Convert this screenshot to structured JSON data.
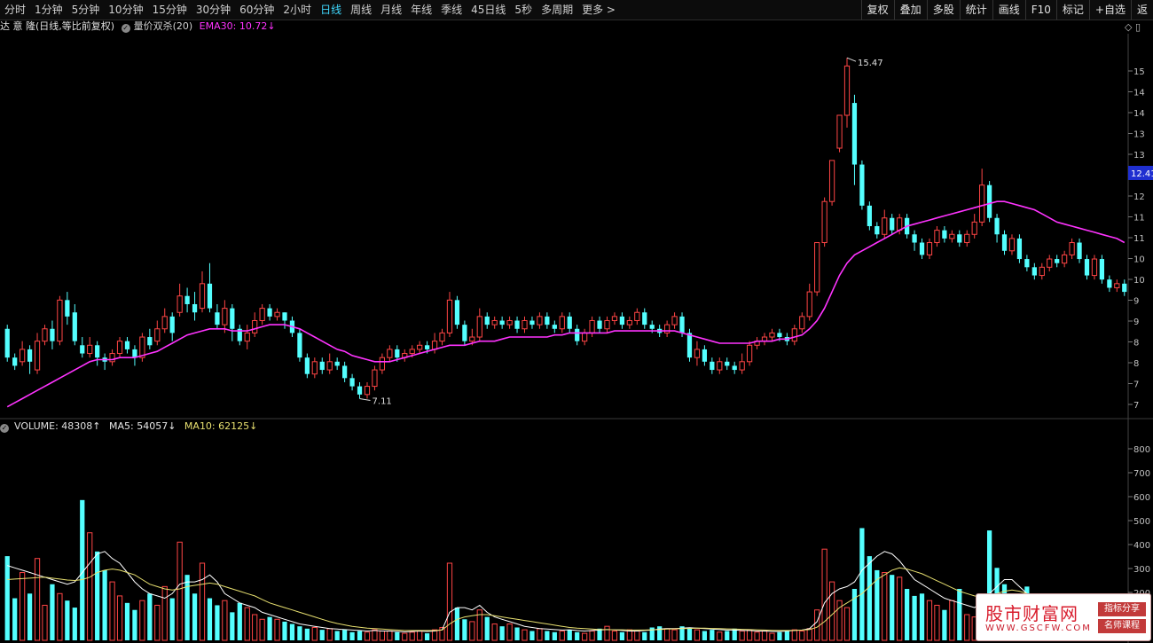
{
  "toolbar": {
    "periods": [
      "分时",
      "1分钟",
      "5分钟",
      "10分钟",
      "15分钟",
      "30分钟",
      "60分钟",
      "2小时",
      "日线",
      "周线",
      "月线",
      "年线",
      "季线",
      "45日线",
      "5秒",
      "多周期",
      "更多"
    ],
    "active_period": "日线",
    "more_arrow": ">",
    "tools": [
      "复权",
      "叠加",
      "多股",
      "统计",
      "画线",
      "F10",
      "标记",
      "+自选",
      "返"
    ]
  },
  "info": {
    "stock": "达 意 隆(日线,等比前复权)",
    "indicator": "量价双杀(20)",
    "ema": "EMA30: 10.72↓",
    "corner": "◇ ▯"
  },
  "volume_line": {
    "vol": "VOLUME: 48308↑",
    "ma5": "MA5: 54057↓",
    "ma10": "MA10: 62125↓"
  },
  "price_axis": [
    "15",
    "14",
    "14",
    "13",
    "13",
    "12",
    "12",
    "11",
    "11",
    "10",
    "10",
    "9",
    "9",
    "8",
    "8",
    "7",
    "7"
  ],
  "current_price_tag": "12.41",
  "volume_axis": [
    "800",
    "700",
    "600",
    "500",
    "400",
    "300",
    "200"
  ],
  "annotations": {
    "high": "15.47",
    "low": "7.11"
  },
  "colors": {
    "up": "#ff3b3b",
    "up_hollow": "#ff4545",
    "down": "#54ffff",
    "ema": "#ff33ff",
    "ma5": "#ffffff",
    "ma10": "#e8e070",
    "green_bar": "#22ee22",
    "yellow_bar": "#ffcc00"
  },
  "watermark": {
    "title": "股市财富网",
    "url": "WWW.GSCFW.COM",
    "tag1": "指标分享",
    "tag2": "名师课程"
  },
  "chart_data": {
    "type": "candlestick",
    "price_range": [
      6.8,
      16.0
    ],
    "volume_range": [
      0,
      880
    ],
    "candles": [
      [
        8.9,
        8.2,
        9.0,
        8.1
      ],
      [
        8.2,
        8.0,
        8.3,
        7.9
      ],
      [
        8.1,
        8.4,
        8.6,
        8.0
      ],
      [
        8.4,
        8.1,
        8.5,
        7.8
      ],
      [
        7.9,
        8.6,
        8.8,
        7.8
      ],
      [
        8.6,
        8.9,
        9.0,
        8.5
      ],
      [
        8.9,
        8.6,
        9.1,
        8.4
      ],
      [
        8.6,
        9.6,
        9.7,
        8.5
      ],
      [
        9.6,
        9.2,
        9.8,
        9.0
      ],
      [
        9.3,
        8.6,
        9.5,
        8.5
      ],
      [
        8.5,
        8.3,
        8.7,
        8.2
      ],
      [
        8.3,
        8.5,
        8.7,
        8.2
      ],
      [
        8.5,
        8.2,
        8.6,
        8.0
      ],
      [
        8.2,
        8.1,
        8.3,
        7.9
      ],
      [
        8.1,
        8.3,
        8.4,
        8.0
      ],
      [
        8.3,
        8.6,
        8.7,
        8.2
      ],
      [
        8.6,
        8.4,
        8.7,
        8.3
      ],
      [
        8.4,
        8.2,
        8.5,
        8.0
      ],
      [
        8.2,
        8.7,
        8.8,
        8.1
      ],
      [
        8.7,
        8.5,
        8.9,
        8.4
      ],
      [
        8.6,
        8.9,
        9.1,
        8.5
      ],
      [
        8.9,
        9.2,
        9.4,
        8.8
      ],
      [
        9.2,
        8.8,
        9.3,
        8.6
      ],
      [
        9.3,
        9.7,
        10.0,
        9.2
      ],
      [
        9.7,
        9.5,
        9.9,
        9.3
      ],
      [
        9.5,
        9.3,
        9.8,
        9.1
      ],
      [
        9.4,
        10.0,
        10.3,
        9.3
      ],
      [
        10.0,
        9.4,
        10.5,
        9.3
      ],
      [
        9.3,
        9.0,
        9.5,
        8.9
      ],
      [
        9.0,
        9.4,
        9.6,
        8.8
      ],
      [
        9.4,
        8.9,
        9.5,
        8.6
      ],
      [
        8.9,
        8.6,
        9.0,
        8.5
      ],
      [
        8.6,
        8.8,
        9.0,
        8.4
      ],
      [
        8.8,
        9.1,
        9.3,
        8.7
      ],
      [
        9.1,
        9.4,
        9.5,
        9.0
      ],
      [
        9.4,
        9.2,
        9.5,
        9.1
      ],
      [
        9.2,
        9.3,
        9.4,
        9.1
      ],
      [
        9.3,
        9.1,
        9.3,
        8.9
      ],
      [
        9.1,
        8.8,
        9.2,
        8.7
      ],
      [
        8.8,
        8.2,
        8.9,
        8.1
      ],
      [
        8.2,
        7.8,
        8.3,
        7.7
      ],
      [
        7.8,
        8.1,
        8.2,
        7.7
      ],
      [
        8.1,
        7.9,
        8.2,
        7.8
      ],
      [
        7.9,
        8.1,
        8.3,
        7.8
      ],
      [
        8.1,
        8.0,
        8.2,
        7.9
      ],
      [
        8.0,
        7.7,
        8.1,
        7.6
      ],
      [
        7.7,
        7.5,
        7.8,
        7.4
      ],
      [
        7.5,
        7.3,
        7.6,
        7.2
      ],
      [
        7.3,
        7.5,
        7.6,
        7.2
      ],
      [
        7.5,
        7.9,
        8.0,
        7.4
      ],
      [
        7.9,
        8.2,
        8.3,
        7.8
      ],
      [
        8.2,
        8.4,
        8.5,
        8.1
      ],
      [
        8.4,
        8.2,
        8.5,
        8.1
      ],
      [
        8.2,
        8.3,
        8.4,
        8.1
      ],
      [
        8.3,
        8.4,
        8.5,
        8.2
      ],
      [
        8.4,
        8.5,
        8.6,
        8.3
      ],
      [
        8.5,
        8.4,
        8.6,
        8.3
      ],
      [
        8.4,
        8.6,
        8.8,
        8.3
      ],
      [
        8.6,
        8.8,
        8.9,
        8.5
      ],
      [
        8.8,
        9.6,
        9.8,
        8.7
      ],
      [
        9.6,
        9.0,
        9.7,
        8.9
      ],
      [
        9.0,
        8.6,
        9.1,
        8.5
      ],
      [
        8.6,
        8.7,
        8.9,
        8.5
      ],
      [
        8.7,
        9.2,
        9.4,
        8.6
      ],
      [
        9.2,
        9.0,
        9.3,
        8.9
      ],
      [
        9.0,
        9.1,
        9.2,
        8.9
      ],
      [
        9.1,
        9.0,
        9.2,
        8.9
      ],
      [
        9.0,
        9.1,
        9.2,
        8.9
      ],
      [
        9.1,
        8.9,
        9.2,
        8.8
      ],
      [
        8.9,
        9.1,
        9.2,
        8.8
      ],
      [
        9.1,
        9.0,
        9.2,
        8.9
      ],
      [
        9.0,
        9.2,
        9.3,
        8.9
      ],
      [
        9.2,
        9.0,
        9.3,
        8.9
      ],
      [
        9.0,
        8.9,
        9.1,
        8.8
      ],
      [
        8.9,
        9.2,
        9.3,
        8.8
      ],
      [
        9.2,
        8.9,
        9.3,
        8.8
      ],
      [
        8.9,
        8.6,
        9.0,
        8.5
      ],
      [
        8.6,
        8.8,
        8.9,
        8.5
      ],
      [
        8.8,
        9.1,
        9.2,
        8.7
      ],
      [
        9.1,
        8.9,
        9.2,
        8.8
      ],
      [
        8.9,
        9.1,
        9.2,
        8.8
      ],
      [
        9.1,
        9.2,
        9.3,
        9.0
      ],
      [
        9.2,
        9.0,
        9.3,
        8.9
      ],
      [
        9.0,
        9.1,
        9.2,
        8.9
      ],
      [
        9.1,
        9.3,
        9.4,
        9.0
      ],
      [
        9.3,
        9.0,
        9.4,
        8.9
      ],
      [
        9.0,
        8.9,
        9.1,
        8.8
      ],
      [
        8.9,
        8.8,
        9.0,
        8.7
      ],
      [
        8.8,
        9.0,
        9.1,
        8.7
      ],
      [
        9.0,
        9.2,
        9.3,
        8.9
      ],
      [
        9.2,
        8.8,
        9.3,
        8.7
      ],
      [
        8.8,
        8.2,
        8.9,
        8.1
      ],
      [
        8.2,
        8.4,
        8.6,
        8.0
      ],
      [
        8.4,
        8.1,
        8.5,
        8.0
      ],
      [
        8.1,
        7.9,
        8.2,
        7.8
      ],
      [
        7.9,
        8.1,
        8.2,
        7.8
      ],
      [
        8.1,
        8.0,
        8.2,
        7.9
      ],
      [
        8.0,
        7.9,
        8.1,
        7.8
      ],
      [
        7.9,
        8.1,
        8.3,
        7.8
      ],
      [
        8.1,
        8.5,
        8.6,
        8.0
      ],
      [
        8.5,
        8.6,
        8.7,
        8.4
      ],
      [
        8.6,
        8.7,
        8.8,
        8.5
      ],
      [
        8.7,
        8.8,
        8.9,
        8.6
      ],
      [
        8.8,
        8.7,
        8.9,
        8.6
      ],
      [
        8.7,
        8.6,
        8.8,
        8.5
      ],
      [
        8.6,
        8.9,
        9.0,
        8.5
      ],
      [
        8.9,
        9.2,
        9.3,
        8.8
      ],
      [
        9.2,
        9.8,
        10.0,
        9.1
      ],
      [
        9.8,
        11.0,
        11.0,
        9.7
      ],
      [
        11.0,
        12.0,
        12.1,
        10.9
      ],
      [
        12.0,
        13.0,
        13.0,
        11.9
      ],
      [
        13.3,
        14.1,
        14.1,
        13.2
      ],
      [
        14.1,
        15.3,
        15.5,
        13.8
      ],
      [
        14.4,
        12.9,
        14.6,
        12.4
      ],
      [
        12.9,
        11.9,
        13.0,
        11.8
      ],
      [
        11.9,
        11.4,
        12.0,
        11.3
      ],
      [
        11.4,
        11.2,
        11.5,
        11.1
      ],
      [
        11.2,
        11.6,
        11.8,
        11.1
      ],
      [
        11.6,
        11.3,
        11.7,
        11.2
      ],
      [
        11.3,
        11.6,
        11.7,
        11.2
      ],
      [
        11.6,
        11.2,
        11.7,
        11.1
      ],
      [
        11.2,
        11.0,
        11.3,
        10.8
      ],
      [
        11.0,
        10.7,
        11.1,
        10.6
      ],
      [
        10.7,
        11.0,
        11.1,
        10.6
      ],
      [
        11.0,
        11.3,
        11.4,
        10.9
      ],
      [
        11.3,
        11.1,
        11.4,
        11.0
      ],
      [
        11.1,
        11.2,
        11.3,
        11.0
      ],
      [
        11.2,
        11.0,
        11.3,
        10.9
      ],
      [
        11.0,
        11.2,
        11.3,
        10.9
      ],
      [
        11.2,
        11.5,
        11.7,
        11.1
      ],
      [
        11.5,
        12.4,
        12.8,
        11.4
      ],
      [
        12.4,
        11.6,
        12.5,
        11.5
      ],
      [
        11.6,
        11.2,
        11.7,
        11.0
      ],
      [
        11.2,
        10.8,
        11.3,
        10.7
      ],
      [
        10.8,
        11.1,
        11.2,
        10.7
      ],
      [
        11.1,
        10.6,
        11.2,
        10.5
      ],
      [
        10.6,
        10.4,
        10.7,
        10.3
      ],
      [
        10.4,
        10.2,
        10.5,
        10.1
      ],
      [
        10.2,
        10.4,
        10.5,
        10.1
      ],
      [
        10.4,
        10.6,
        10.7,
        10.3
      ],
      [
        10.6,
        10.5,
        10.7,
        10.4
      ],
      [
        10.5,
        10.7,
        10.8,
        10.4
      ],
      [
        10.7,
        11.0,
        11.1,
        10.6
      ],
      [
        11.0,
        10.6,
        11.1,
        10.5
      ],
      [
        10.6,
        10.2,
        10.7,
        10.1
      ],
      [
        10.2,
        10.6,
        10.7,
        10.1
      ],
      [
        10.6,
        10.1,
        10.7,
        10.0
      ],
      [
        10.1,
        9.9,
        10.2,
        9.8
      ],
      [
        9.9,
        10.0,
        10.1,
        9.8
      ],
      [
        10.0,
        9.8,
        10.1,
        9.7
      ]
    ],
    "volume": [
      360,
      180,
      290,
      200,
      350,
      150,
      240,
      200,
      170,
      140,
      600,
      460,
      380,
      300,
      250,
      190,
      160,
      130,
      170,
      200,
      150,
      230,
      180,
      420,
      280,
      200,
      330,
      180,
      150,
      170,
      120,
      160,
      140,
      110,
      90,
      100,
      90,
      80,
      70,
      60,
      50,
      55,
      45,
      50,
      40,
      45,
      35,
      40,
      35,
      45,
      40,
      40,
      35,
      30,
      35,
      40,
      30,
      45,
      55,
      330,
      140,
      90,
      80,
      130,
      100,
      70,
      60,
      70,
      55,
      45,
      40,
      50,
      40,
      35,
      40,
      45,
      35,
      30,
      40,
      50,
      60,
      40,
      35,
      45,
      40,
      35,
      55,
      60,
      50,
      45,
      60,
      55,
      45,
      40,
      45,
      35,
      40,
      50,
      40,
      45,
      35,
      40,
      30,
      35,
      40,
      45,
      40,
      50,
      130,
      390,
      250,
      170,
      140,
      220,
      480,
      360,
      300,
      290,
      280,
      270,
      220,
      190,
      200,
      170,
      150,
      130,
      170,
      220,
      110,
      100,
      130,
      470,
      310,
      240,
      160,
      90,
      230,
      140,
      150,
      90,
      85,
      150,
      70,
      110,
      80,
      95,
      60,
      70
    ],
    "ema30": [
      7.0,
      7.1,
      7.2,
      7.3,
      7.4,
      7.5,
      7.6,
      7.7,
      7.8,
      7.9,
      8.0,
      8.1,
      8.15,
      8.15,
      8.15,
      8.2,
      8.2,
      8.2,
      8.25,
      8.3,
      8.35,
      8.45,
      8.55,
      8.65,
      8.75,
      8.8,
      8.85,
      8.9,
      8.9,
      8.9,
      8.85,
      8.85,
      8.85,
      8.9,
      8.95,
      9.0,
      9.0,
      9.0,
      8.95,
      8.9,
      8.8,
      8.7,
      8.6,
      8.5,
      8.4,
      8.35,
      8.25,
      8.2,
      8.15,
      8.1,
      8.1,
      8.1,
      8.15,
      8.2,
      8.25,
      8.3,
      8.35,
      8.4,
      8.45,
      8.5,
      8.5,
      8.5,
      8.55,
      8.6,
      8.6,
      8.6,
      8.65,
      8.7,
      8.7,
      8.7,
      8.7,
      8.7,
      8.7,
      8.75,
      8.75,
      8.8,
      8.8,
      8.8,
      8.8,
      8.8,
      8.8,
      8.85,
      8.85,
      8.85,
      8.85,
      8.85,
      8.85,
      8.85,
      8.85,
      8.85,
      8.8,
      8.75,
      8.7,
      8.65,
      8.6,
      8.55,
      8.55,
      8.55,
      8.55,
      8.55,
      8.6,
      8.6,
      8.6,
      8.65,
      8.65,
      8.7,
      8.75,
      8.9,
      9.1,
      9.4,
      9.8,
      10.2,
      10.5,
      10.7,
      10.8,
      10.9,
      11.0,
      11.1,
      11.2,
      11.3,
      11.4,
      11.45,
      11.5,
      11.55,
      11.6,
      11.65,
      11.7,
      11.75,
      11.8,
      11.85,
      11.9,
      11.95,
      12.0,
      12.0,
      11.95,
      11.9,
      11.85,
      11.8,
      11.7,
      11.6,
      11.5,
      11.45,
      11.4,
      11.35,
      11.3,
      11.25,
      11.2,
      11.15,
      11.1,
      11.0
    ],
    "ma5_vol": [
      320,
      310,
      300,
      290,
      280,
      270,
      260,
      250,
      240,
      250,
      290,
      330,
      370,
      380,
      350,
      330,
      290,
      250,
      220,
      200,
      190,
      180,
      200,
      240,
      250,
      250,
      260,
      280,
      250,
      200,
      180,
      160,
      150,
      140,
      120,
      110,
      100,
      90,
      80,
      70,
      65,
      60,
      55,
      50,
      48,
      46,
      44,
      42,
      40,
      42,
      40,
      40,
      38,
      36,
      38,
      40,
      38,
      40,
      45,
      120,
      140,
      140,
      130,
      150,
      120,
      100,
      90,
      80,
      70,
      60,
      55,
      50,
      48,
      46,
      44,
      45,
      42,
      40,
      42,
      44,
      46,
      45,
      42,
      40,
      40,
      42,
      44,
      48,
      50,
      50,
      52,
      54,
      52,
      50,
      48,
      46,
      44,
      44,
      42,
      42,
      40,
      40,
      38,
      38,
      40,
      42,
      44,
      50,
      80,
      160,
      200,
      220,
      230,
      250,
      300,
      330,
      360,
      380,
      370,
      340,
      300,
      260,
      240,
      220,
      200,
      180,
      170,
      160,
      150,
      140,
      160,
      200,
      230,
      260,
      260,
      230,
      200,
      180,
      160,
      150,
      140,
      130,
      120,
      110,
      100,
      95,
      90,
      85
    ],
    "ma10_vol": [
      260,
      262,
      264,
      266,
      268,
      270,
      266,
      262,
      258,
      256,
      260,
      270,
      290,
      300,
      305,
      300,
      290,
      280,
      260,
      240,
      230,
      220,
      215,
      220,
      230,
      235,
      240,
      245,
      240,
      230,
      220,
      210,
      200,
      190,
      175,
      160,
      150,
      140,
      130,
      120,
      110,
      100,
      90,
      80,
      72,
      66,
      60,
      56,
      52,
      50,
      48,
      46,
      44,
      42,
      42,
      42,
      42,
      42,
      44,
      70,
      90,
      100,
      105,
      110,
      110,
      105,
      100,
      95,
      90,
      85,
      80,
      75,
      70,
      65,
      60,
      55,
      52,
      50,
      48,
      46,
      46,
      45,
      45,
      44,
      44,
      44,
      45,
      46,
      48,
      49,
      50,
      51,
      52,
      52,
      51,
      50,
      49,
      48,
      47,
      46,
      45,
      44,
      43,
      42,
      42,
      43,
      44,
      46,
      56,
      80,
      110,
      140,
      160,
      180,
      200,
      230,
      260,
      280,
      300,
      310,
      305,
      295,
      285,
      270,
      255,
      240,
      225,
      210,
      200,
      190,
      185,
      190,
      200,
      210,
      215,
      210,
      200,
      190,
      180,
      170,
      160,
      150,
      142,
      135,
      128,
      122,
      116,
      110
    ]
  }
}
